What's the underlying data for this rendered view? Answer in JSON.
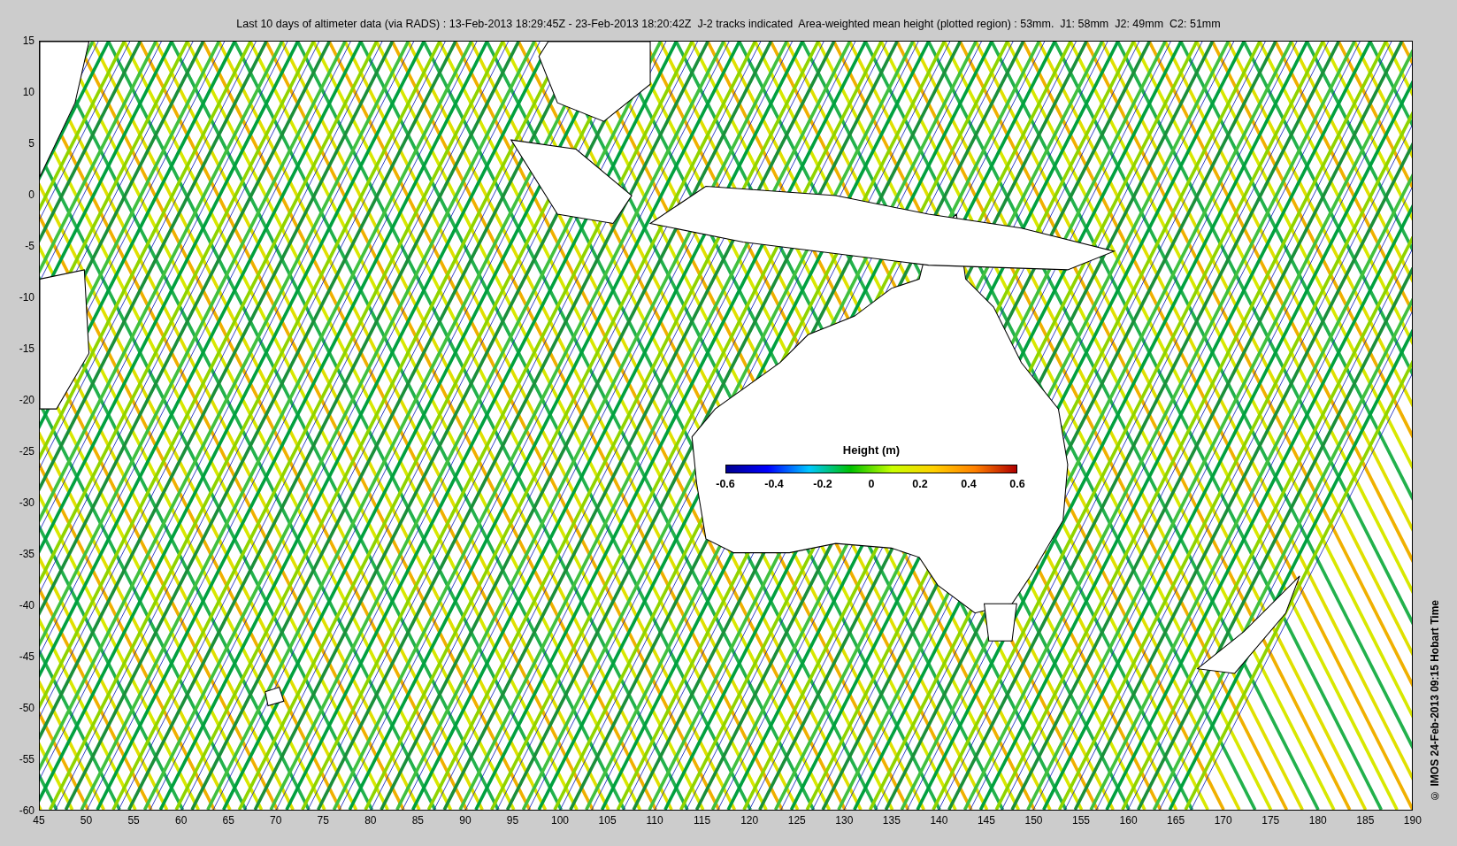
{
  "title": "Last 10 days of altimeter data (via RADS) : 13-Feb-2013 18:29:45Z - 23-Feb-2013 18:20:42Z  J-2 tracks indicated  Area-weighted mean height (plotted region) : 53mm.  J1: 58mm  J2: 49mm  C2: 51mm",
  "y_ticks": [
    "15",
    "10",
    "5",
    "0",
    "-5",
    "-10",
    "-15",
    "-20",
    "-25",
    "-30",
    "-35",
    "-40",
    "-45",
    "-50",
    "-55",
    "-60"
  ],
  "x_ticks": [
    "45",
    "50",
    "55",
    "60",
    "65",
    "70",
    "75",
    "80",
    "85",
    "90",
    "95",
    "100",
    "105",
    "110",
    "115",
    "120",
    "125",
    "130",
    "135",
    "140",
    "145",
    "150",
    "155",
    "160",
    "165",
    "170",
    "175",
    "180",
    "185",
    "190"
  ],
  "colorbar": {
    "label": "Height (m)",
    "ticks": [
      "-0.6",
      "-0.4",
      "-0.2",
      "0",
      "0.2",
      "0.4",
      "0.6"
    ]
  },
  "credit": "© IMOS 24-Feb-2013 09:15 Hobart Time"
}
